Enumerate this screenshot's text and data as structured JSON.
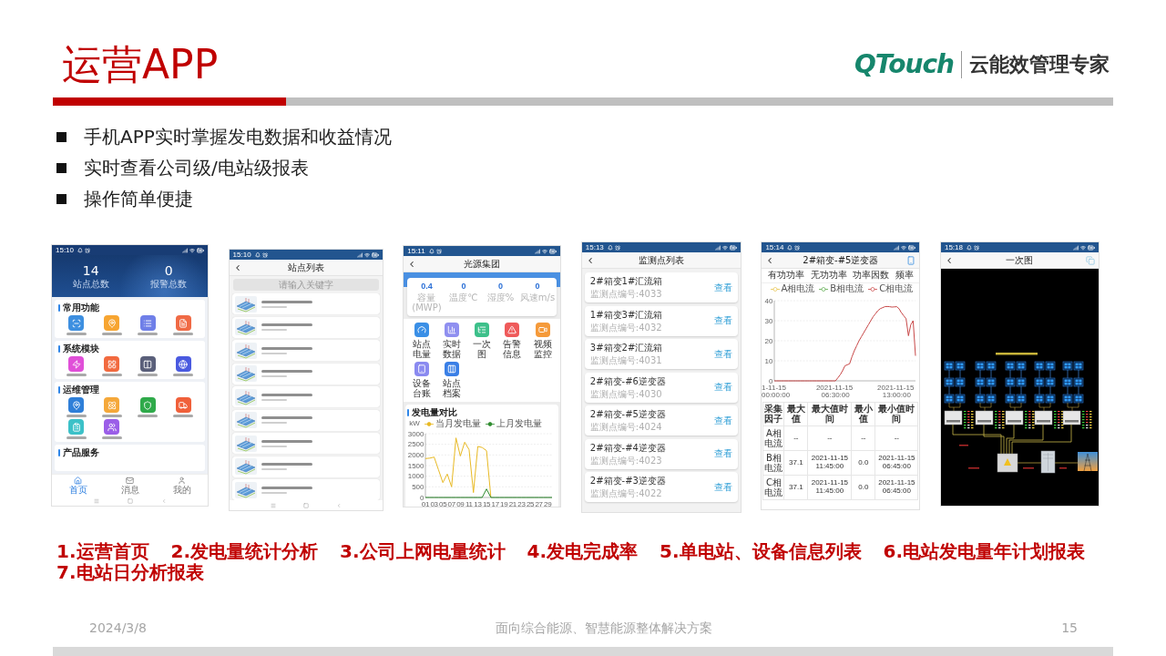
{
  "slide": {
    "title": "运营APP",
    "logo": {
      "brand": "QTouch",
      "tagline": "云能效管理专家"
    }
  },
  "bullets": [
    "手机APP实时掌握发电数据和收益情况",
    "实时查看公司级/电站级报表",
    "操作简单便捷"
  ],
  "phones": [
    {
      "kind": "home",
      "status_time": "15:10",
      "android_nav": true,
      "stats": [
        {
          "value": "14",
          "label": "站点总数"
        },
        {
          "value": "0",
          "label": "报警总数"
        }
      ],
      "sections": [
        {
          "title": "常用功能",
          "tiles": [
            {
              "color": "#3d8fe0"
            },
            {
              "color": "#f7a531"
            },
            {
              "color": "#6f7fe8"
            },
            {
              "color": "#f06a45"
            }
          ]
        },
        {
          "title": "系统模块",
          "tiles": [
            {
              "color": "#e04fd8"
            },
            {
              "color": "#f26a3f"
            },
            {
              "color": "#5a5f7a"
            },
            {
              "color": "#4a5ae0"
            }
          ]
        },
        {
          "title": "运维管理",
          "tiles": [
            {
              "color": "#2f7fd8"
            },
            {
              "color": "#f5a83a"
            },
            {
              "color": "#2faa4a"
            },
            {
              "color": "#f0603a"
            },
            {
              "color": "#3cc1c8"
            },
            {
              "color": "#9b5ee8"
            }
          ]
        },
        {
          "title": "产品服务"
        }
      ],
      "tabs": [
        {
          "label": "首页",
          "selected": true
        },
        {
          "label": "消息",
          "selected": false
        },
        {
          "label": "我的",
          "selected": false
        }
      ]
    },
    {
      "kind": "station_list",
      "status_time": "15:10",
      "android_nav": true,
      "title": "站点列表",
      "search": {
        "placeholder": "请输入关键字"
      },
      "stations": [
        {
          "kind": "station"
        },
        {
          "kind": "station"
        },
        {
          "kind": "station"
        },
        {
          "kind": "station"
        },
        {
          "kind": "station"
        },
        {
          "kind": "station"
        },
        {
          "kind": "station"
        },
        {
          "kind": "station"
        },
        {
          "kind": "station"
        }
      ]
    },
    {
      "kind": "station_detail",
      "status_time": "15:11",
      "title": "光源集团",
      "stats": [
        {
          "value": "0.4",
          "label": "容量(MWP)"
        },
        {
          "value": "0",
          "label": "温度℃"
        },
        {
          "value": "0",
          "label": "湿度%"
        },
        {
          "value": "0",
          "label": "风速m/s"
        }
      ],
      "functions": [
        {
          "label": "站点电量",
          "color": "#3a8fe6"
        },
        {
          "label": "实时数据",
          "color": "#8f8ff0"
        },
        {
          "label": "一次图",
          "color": "#3cc08a"
        },
        {
          "label": "告警信息",
          "color": "#ef5a5a"
        },
        {
          "label": "视频监控",
          "color": "#f59a3a"
        },
        {
          "label": "设备台账",
          "color": "#8a8af0"
        },
        {
          "label": "站点档案",
          "color": "#3a7fe6"
        }
      ],
      "chart": {
        "chart_data": {
          "type": "line",
          "title": "发电量对比",
          "ylabel": "kW",
          "grid": true,
          "x": [
            1,
            2,
            3,
            4,
            5,
            6,
            7,
            8,
            9,
            10,
            11,
            12,
            13,
            14,
            15,
            16,
            17,
            18,
            19,
            20,
            21,
            22,
            23,
            24,
            25,
            26,
            27,
            28,
            29,
            30
          ],
          "xlim": [
            1,
            30
          ],
          "ylim": [
            0,
            3000
          ],
          "xticks": [
            {
              "value": 1,
              "label": "01"
            },
            {
              "value": 3,
              "label": "03"
            },
            {
              "value": 5,
              "label": "05"
            },
            {
              "value": 7,
              "label": "07"
            },
            {
              "value": 9,
              "label": "09"
            },
            {
              "value": 11,
              "label": "11"
            },
            {
              "value": 13,
              "label": "13"
            },
            {
              "value": 15,
              "label": "15"
            },
            {
              "value": 17,
              "label": "17"
            },
            {
              "value": 19,
              "label": "19"
            },
            {
              "value": 21,
              "label": "21"
            },
            {
              "value": 23,
              "label": "23"
            },
            {
              "value": 25,
              "label": "25"
            },
            {
              "value": 27,
              "label": "27"
            },
            {
              "value": 29,
              "label": "29"
            }
          ],
          "yticks": [
            0,
            500,
            1000,
            1500,
            2000,
            2500,
            3000
          ],
          "series": [
            {
              "name": "当月发电量",
              "color": "#e8b923",
              "values": [
                1830,
                1850,
                1900,
                1300,
                700,
                1100,
                500,
                2800,
                1950,
                2600,
                2250,
                230,
                2400,
                2350,
                2200,
                0,
                null,
                null,
                null,
                null,
                null,
                null,
                null,
                null,
                null,
                null,
                null,
                null,
                null,
                null
              ]
            },
            {
              "name": "上月发电量",
              "color": "#2e8b2e",
              "values": [
                0,
                0,
                0,
                0,
                0,
                0,
                0,
                0,
                0,
                0,
                0,
                0,
                0,
                0,
                400,
                0,
                0,
                0,
                0,
                0,
                0,
                0,
                0,
                0,
                0,
                0,
                0,
                0,
                0,
                0
              ]
            }
          ]
        }
      }
    },
    {
      "kind": "monitor_list",
      "status_time": "15:13",
      "title": "监测点列表",
      "points": [
        {
          "name": "2#箱变1#汇流箱",
          "code": "监测点编号:4033",
          "action": "查看"
        },
        {
          "name": "1#箱变3#汇流箱",
          "code": "监测点编号:4032",
          "action": "查看"
        },
        {
          "name": "3#箱变2#汇流箱",
          "code": "监测点编号:4031",
          "action": "查看"
        },
        {
          "name": "2#箱变-#6逆变器",
          "code": "监测点编号:4030",
          "action": "查看"
        },
        {
          "name": "2#箱变-#5逆变器",
          "code": "监测点编号:4024",
          "action": "查看"
        },
        {
          "name": "2#箱变-#4逆变器",
          "code": "监测点编号:4023",
          "action": "查看"
        },
        {
          "name": "2#箱变-#3逆变器",
          "code": "监测点编号:4022",
          "action": "查看"
        }
      ]
    },
    {
      "kind": "device_detail",
      "status_time": "15:14",
      "title": "2#箱变-#5逆变器",
      "tabs": [
        {
          "label": "有功功率",
          "selected": false
        },
        {
          "label": "无功功率",
          "selected": false
        },
        {
          "label": "功率因数",
          "selected": false
        },
        {
          "label": "频率",
          "selected": false
        }
      ],
      "chart_data": {
        "type": "line",
        "grid": true,
        "categories": [
          "1-11-15 00:00:00",
          null,
          null,
          null,
          null,
          null,
          null,
          null,
          null,
          null,
          null,
          null,
          null,
          null,
          null,
          null,
          null,
          null,
          null,
          null,
          null,
          null,
          null,
          null,
          null,
          null,
          "2021-11-15 06:30:00",
          null,
          null,
          null,
          null,
          null,
          null,
          null,
          null,
          null,
          null,
          null,
          null,
          null,
          null,
          null,
          null,
          null,
          null,
          null,
          null,
          null,
          null,
          null,
          null,
          null,
          "2021-11-15 13:00:00",
          null,
          null,
          null,
          null,
          null,
          null,
          null,
          null
        ],
        "ylim": [
          0,
          40
        ],
        "yticks": [
          0,
          10,
          20,
          30,
          40
        ],
        "series": [
          {
            "name": "A相电流",
            "color": "#e6c34a",
            "values": [
              null,
              null,
              null,
              null,
              null,
              null,
              null,
              null,
              null,
              null,
              null,
              null,
              null,
              null,
              null,
              null,
              null,
              null,
              null,
              null,
              null,
              null,
              null,
              null,
              null,
              null,
              null,
              null,
              null,
              null,
              null,
              null,
              null,
              null,
              null,
              null,
              null,
              null,
              null,
              null,
              null,
              null,
              null,
              null,
              null,
              null,
              null,
              null,
              null,
              null,
              null,
              null,
              null,
              null,
              null,
              null,
              null,
              null,
              null,
              null,
              null
            ]
          },
          {
            "name": "B相电流",
            "color": "#5aaa4a",
            "values": [
              null,
              null,
              null,
              null,
              null,
              null,
              null,
              null,
              null,
              null,
              null,
              null,
              null,
              null,
              null,
              null,
              null,
              null,
              null,
              null,
              null,
              null,
              null,
              null,
              null,
              null,
              null,
              null,
              null,
              null,
              null,
              null,
              null,
              null,
              null,
              null,
              null,
              null,
              null,
              null,
              null,
              null,
              null,
              null,
              null,
              null,
              null,
              null,
              null,
              null,
              null,
              null,
              null,
              null,
              null,
              null,
              null,
              null,
              null,
              null,
              null
            ]
          },
          {
            "name": "C相电流",
            "color": "#c84848",
            "values": [
              0,
              0,
              0,
              0,
              0,
              0,
              0,
              0,
              0,
              0,
              0,
              0,
              0,
              0,
              0,
              0,
              0,
              0,
              0,
              0,
              0,
              0,
              0,
              0,
              0,
              0,
              0,
              1.5,
              3,
              5,
              7.5,
              8,
              8.5,
              12,
              15,
              17.5,
              20,
              22,
              24,
              26,
              28,
              30,
              32,
              33.5,
              35,
              36,
              36.5,
              37,
              37.1,
              37,
              36.8,
              36.9,
              37,
              36,
              34,
              32.5,
              31,
              22.5,
              28,
              30,
              12.5
            ]
          }
        ]
      },
      "table": {
        "columns": [
          "采集因子",
          "最大值",
          "最大值时间",
          "最小值",
          "最小值时间"
        ],
        "rows": [
          [
            "A相电流",
            "--",
            "--",
            "--",
            "--"
          ],
          [
            "B相电流",
            "37.1",
            "2021-11-15 11:45:00",
            "0.0",
            "2021-11-15 06:45:00"
          ],
          [
            "C相电流",
            "37.1",
            "2021-11-15 11:45:00",
            "0.0",
            "2021-11-15 06:45:00"
          ]
        ]
      }
    },
    {
      "kind": "diagram",
      "status_time": "15:18",
      "title": "一次图"
    }
  ],
  "captions": [
    "1.运营首页",
    "2.发电量统计分析",
    "3.公司上网电量统计",
    "4.发电完成率",
    "5.单电站、设备信息列表",
    "6.电站发电量年计划报表",
    "7.电站日分析报表"
  ],
  "footer": {
    "date": "2024/3/8",
    "subtitle": "面向综合能源、智慧能源整体解决方案",
    "page": "15"
  }
}
